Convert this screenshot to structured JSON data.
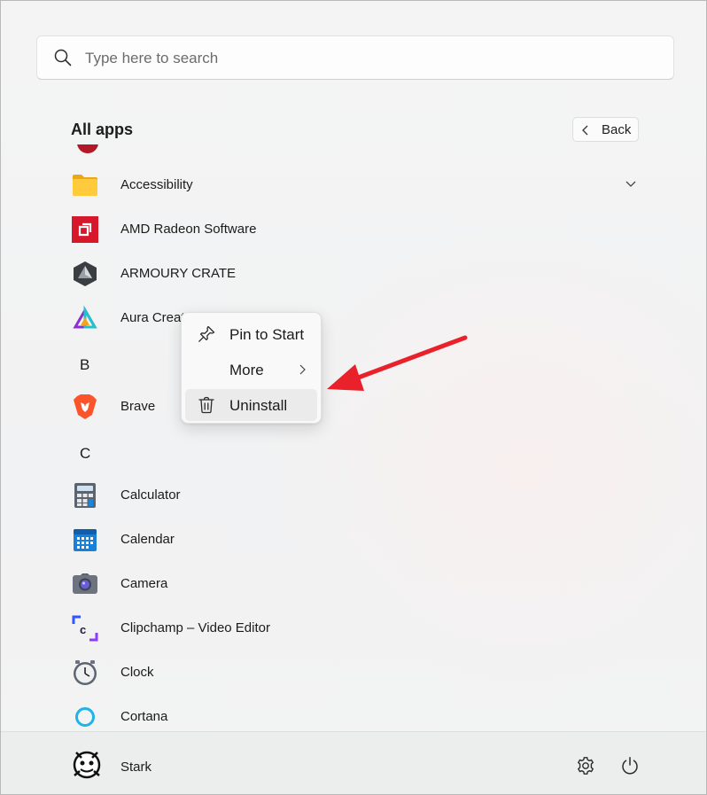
{
  "search": {
    "placeholder": "Type here to search"
  },
  "header": {
    "title": "All apps",
    "back_label": "Back"
  },
  "apps": [
    {
      "name": "Accessibility",
      "icon": "folder-icon",
      "expandable": true
    },
    {
      "name": "AMD Radeon Software",
      "icon": "amd-radeon-icon"
    },
    {
      "name": "ARMOURY CRATE",
      "icon": "armoury-crate-icon"
    },
    {
      "name": "Aura Creator",
      "icon": "aura-creator-icon"
    },
    {
      "name": "Brave",
      "icon": "brave-icon"
    },
    {
      "name": "Calculator",
      "icon": "calculator-icon"
    },
    {
      "name": "Calendar",
      "icon": "calendar-icon"
    },
    {
      "name": "Camera",
      "icon": "camera-icon"
    },
    {
      "name": "Clipchamp – Video Editor",
      "icon": "clipchamp-icon"
    },
    {
      "name": "Clock",
      "icon": "clock-icon"
    },
    {
      "name": "Cortana",
      "icon": "cortana-icon"
    }
  ],
  "sections": {
    "b": "B",
    "c": "C"
  },
  "context_menu": {
    "items": [
      {
        "label": "Pin to Start",
        "icon": "pin-icon"
      },
      {
        "label": "More",
        "icon": "chevron-right-icon"
      },
      {
        "label": "Uninstall",
        "icon": "trash-icon"
      }
    ]
  },
  "footer": {
    "user_name": "Stark"
  },
  "colors": {
    "annotation_arrow": "#e8212b",
    "accent": "#0067c0"
  }
}
